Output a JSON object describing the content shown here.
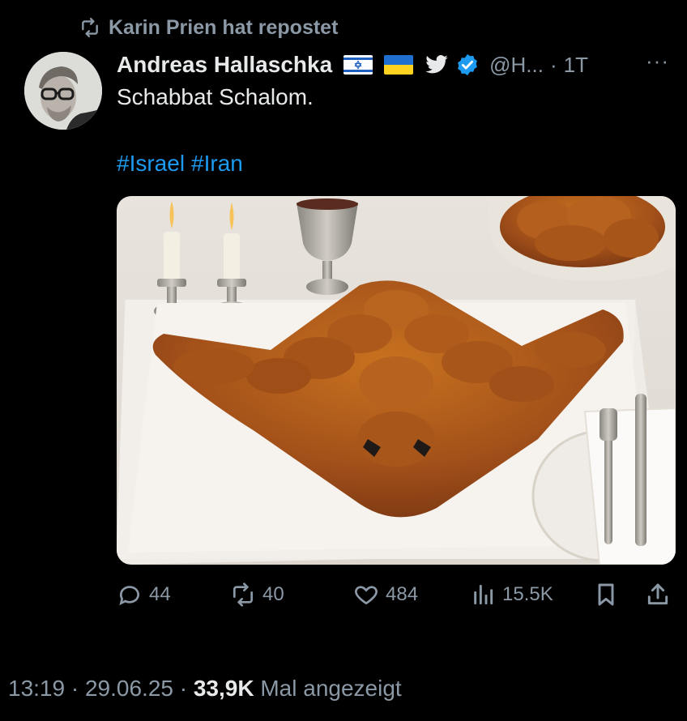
{
  "repost": {
    "icon": "repost-icon",
    "text": "Karin Prien hat repostet"
  },
  "tweet": {
    "author_name": "Andreas Hallaschka",
    "flags": [
      "israel-flag",
      "ukraine-flag"
    ],
    "handle": "@H...",
    "separator": "·",
    "time": "1T",
    "more_label": "···",
    "text": "Schabbat Schalom.",
    "hashtags": [
      "#Israel",
      "#Iran"
    ]
  },
  "actions": {
    "replies": "44",
    "reposts": "40",
    "likes": "484",
    "views": "15.5K"
  },
  "footer": {
    "time": "13:19",
    "sep1": "·",
    "date": "29.06.25",
    "sep2": "·",
    "views_count": "33,9K",
    "views_label": "Mal angezeigt"
  },
  "colors": {
    "background": "#000000",
    "text": "#e7e9ea",
    "muted": "#8b98a5",
    "link": "#1d9bf0",
    "verified": "#1d9bf0"
  }
}
